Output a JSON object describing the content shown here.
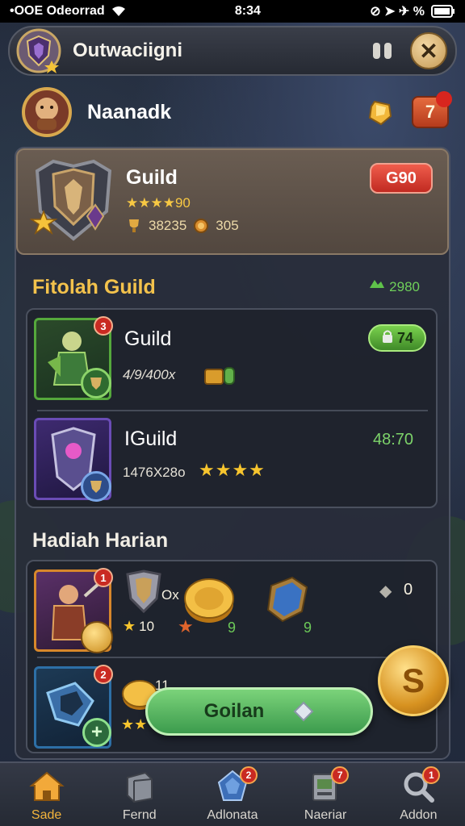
{
  "status_bar": {
    "carrier": "•OOE Odeorrad",
    "time": "8:34",
    "indicators": "⊘ ➤ ✈ %",
    "battery_icon": "battery-icon"
  },
  "top_bar": {
    "title": "Outwaciigni",
    "pause_icon": "pause-icon",
    "close_label": "✕"
  },
  "player": {
    "name": "Naanadk",
    "notification_count": "7"
  },
  "guild_card": {
    "name": "Guild",
    "rating": "★★★★90",
    "stat_1": "38235",
    "stat_2": "305",
    "badge": "G90"
  },
  "featured_section": {
    "title": "Fitolah Guild",
    "value": "2980",
    "items": [
      {
        "name": "Guild",
        "subtitle": "4/9/400x",
        "badge": "3",
        "pill": "74"
      },
      {
        "name": "IGuild",
        "subtitle": "1476X28o",
        "value": "48:70",
        "stars": "★★★★"
      }
    ]
  },
  "daily_section": {
    "title": "Hadiah Harian",
    "rewards": [
      {
        "badge": "1",
        "label_1": "Ox",
        "stars_label": "10",
        "green_1": "9",
        "green_2": "9",
        "right_value": "0"
      },
      {
        "badge": "2",
        "label_1": "11"
      }
    ]
  },
  "action_button": {
    "label": "Goilan"
  },
  "big_coin": {
    "symbol": "S"
  },
  "bottom_nav": [
    {
      "label": "Sade",
      "icon": "home-icon",
      "badge": ""
    },
    {
      "label": "Fernd",
      "icon": "crate-icon",
      "badge": ""
    },
    {
      "label": "Adlonata",
      "icon": "gem-icon",
      "badge": "2"
    },
    {
      "label": "Naeriar",
      "icon": "map-icon",
      "badge": "7"
    },
    {
      "label": "Addon",
      "icon": "search-icon",
      "badge": "1"
    }
  ],
  "colors": {
    "accent_gold": "#f3c24c",
    "accent_green": "#7dd46a",
    "badge_red": "#c92a22"
  }
}
